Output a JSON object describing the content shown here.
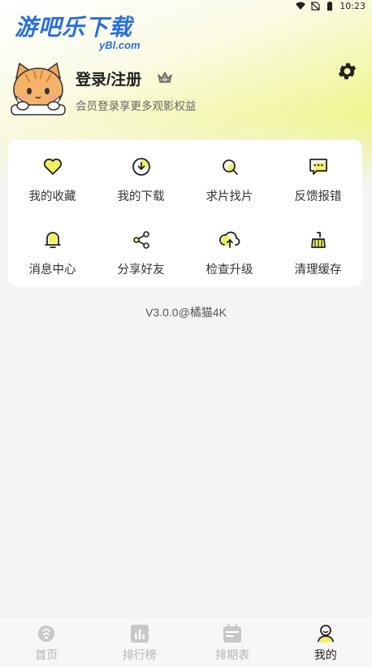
{
  "status_bar": {
    "time": "10:23"
  },
  "watermark": {
    "title": "游吧乐下载",
    "sub": "yBl.com"
  },
  "profile": {
    "name": "登录/注册",
    "subtitle": "会员登录享更多观影权益"
  },
  "menu": {
    "items": [
      {
        "label": "我的收藏",
        "icon": "heart-icon"
      },
      {
        "label": "我的下载",
        "icon": "download-icon"
      },
      {
        "label": "求片找片",
        "icon": "search-film-icon"
      },
      {
        "label": "反馈报错",
        "icon": "feedback-icon"
      },
      {
        "label": "消息中心",
        "icon": "bell-icon"
      },
      {
        "label": "分享好友",
        "icon": "share-icon"
      },
      {
        "label": "检查升级",
        "icon": "upgrade-icon"
      },
      {
        "label": "清理缓存",
        "icon": "broom-icon"
      }
    ]
  },
  "version": "V3.0.0@橘猫4K",
  "tabbar": {
    "tabs": [
      {
        "label": "首页",
        "icon": "home-icon"
      },
      {
        "label": "排行榜",
        "icon": "chart-icon"
      },
      {
        "label": "排期表",
        "icon": "calendar-icon"
      },
      {
        "label": "我的",
        "icon": "user-icon",
        "active": true
      }
    ]
  },
  "colors": {
    "accent": "#e8f36a",
    "accent_fill": "#f0f060",
    "text": "#333333",
    "inactive": "#b5b5b5"
  }
}
